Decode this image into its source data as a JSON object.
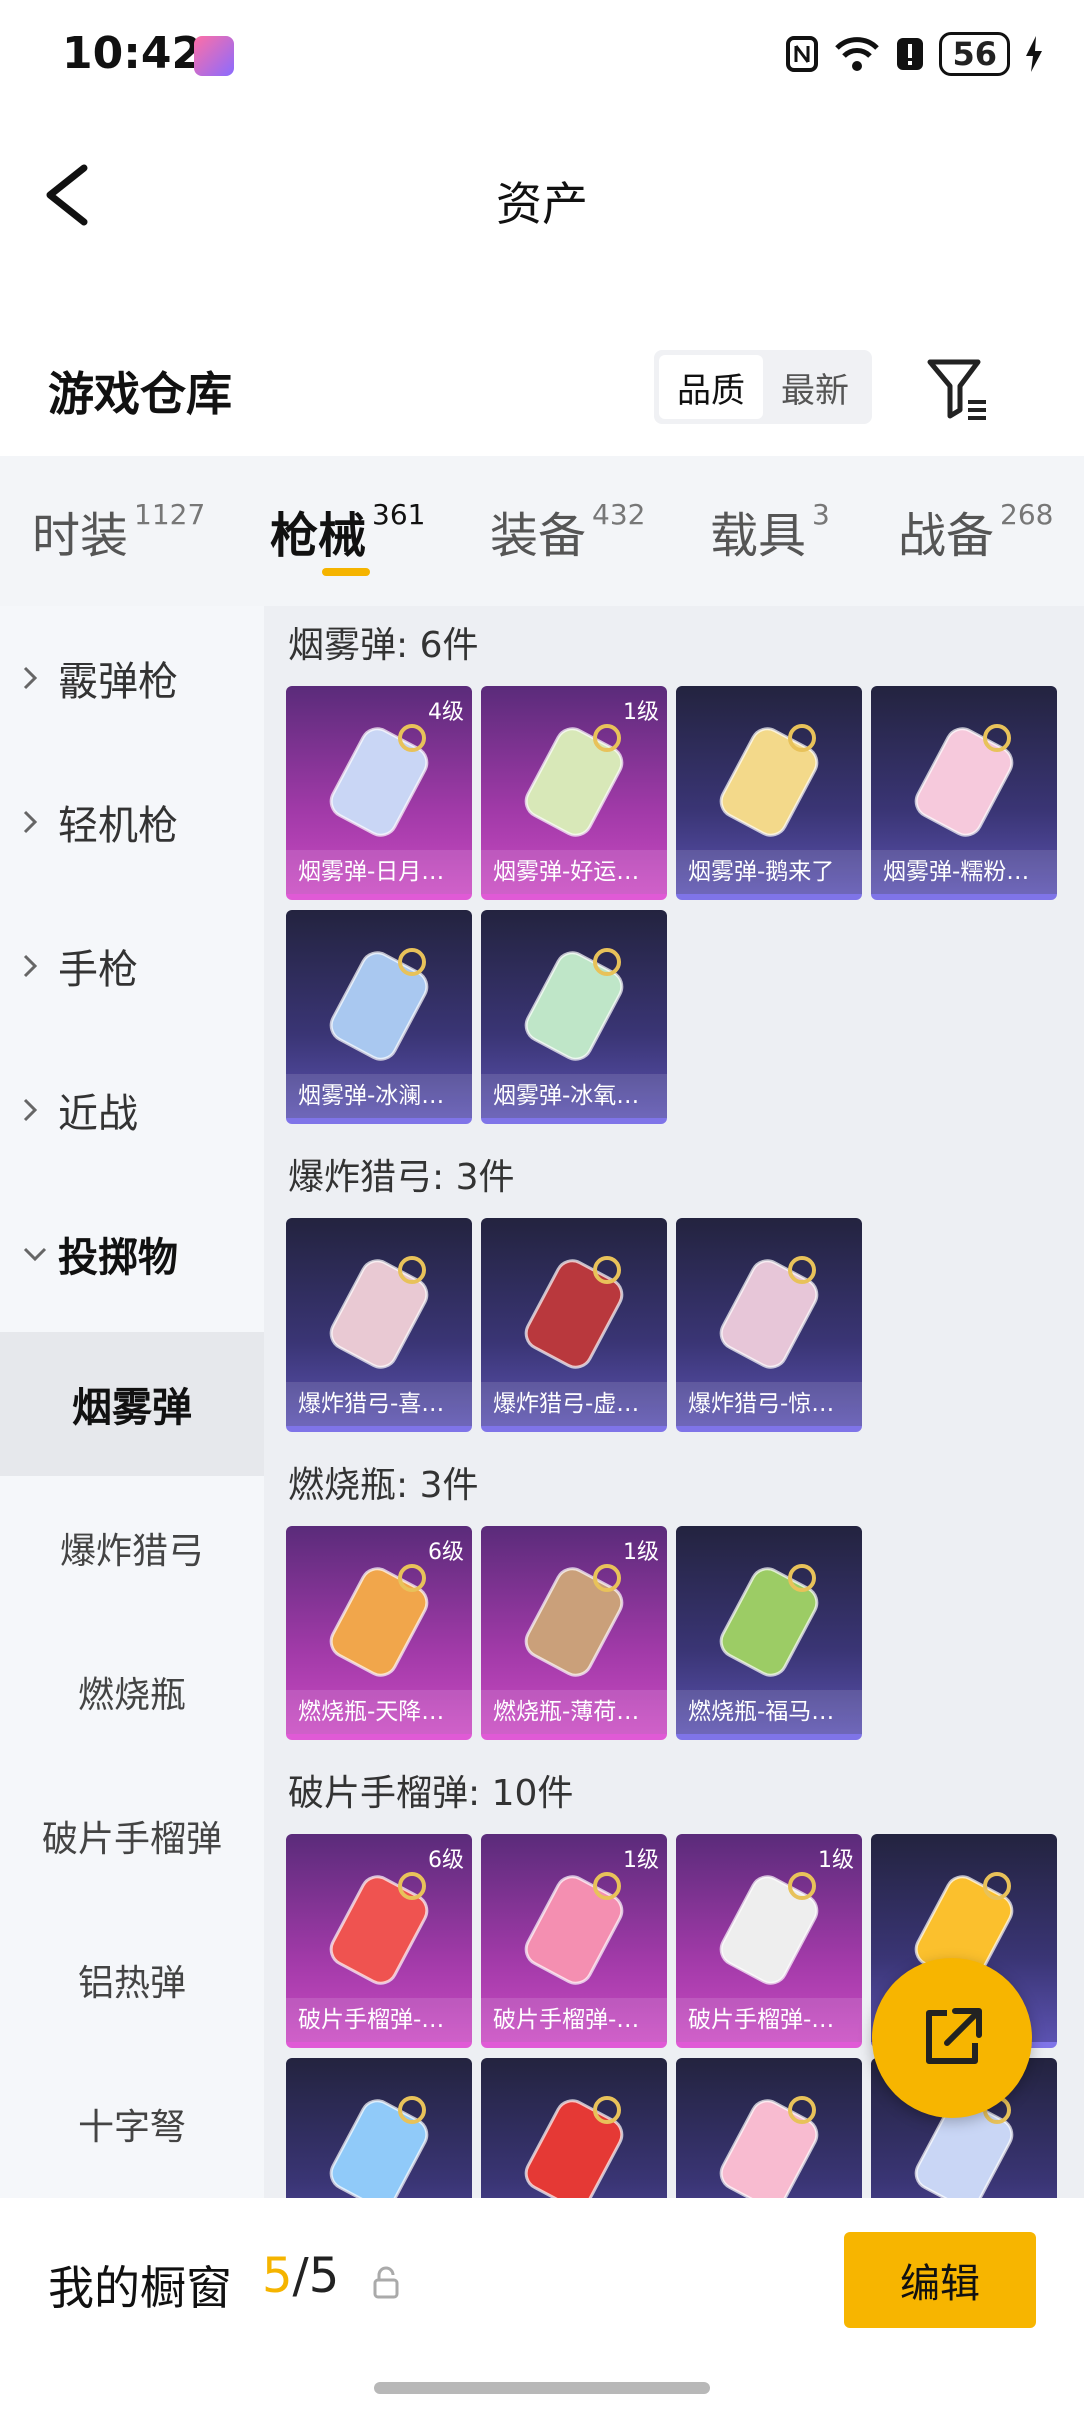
{
  "status_bar": {
    "time": "10:42",
    "battery": "56"
  },
  "header": {
    "title": "资产"
  },
  "warehouse": {
    "title": "游戏仓库",
    "sort_options": [
      {
        "label": "品质"
      },
      {
        "label": "最新"
      }
    ]
  },
  "tabs": [
    {
      "label": "时装",
      "count": "1127"
    },
    {
      "label": "枪械",
      "count": "361"
    },
    {
      "label": "装备",
      "count": "432"
    },
    {
      "label": "载具",
      "count": "3"
    },
    {
      "label": "战备",
      "count": "268"
    }
  ],
  "sidebar": {
    "categories": [
      {
        "label": "霰弹枪"
      },
      {
        "label": "轻机枪"
      },
      {
        "label": "手枪"
      },
      {
        "label": "近战"
      },
      {
        "label": "投掷物"
      }
    ],
    "subcategories": [
      {
        "label": "烟雾弹"
      },
      {
        "label": "爆炸猎弓"
      },
      {
        "label": "燃烧瓶"
      },
      {
        "label": "破片手榴弹"
      },
      {
        "label": "铝热弹"
      },
      {
        "label": "十字弩"
      }
    ]
  },
  "sections": [
    {
      "title": "烟雾弹: 6件",
      "items": [
        {
          "name": "烟雾弹-日月…",
          "level": "4级",
          "rarity": "purple"
        },
        {
          "name": "烟雾弹-好运…",
          "level": "1级",
          "rarity": "purple"
        },
        {
          "name": "烟雾弹-鹅来了",
          "level": "",
          "rarity": "blue"
        },
        {
          "name": "烟雾弹-糯粉…",
          "level": "",
          "rarity": "blue"
        },
        {
          "name": "烟雾弹-冰澜…",
          "level": "",
          "rarity": "blue"
        },
        {
          "name": "烟雾弹-冰氧…",
          "level": "",
          "rarity": "blue"
        }
      ]
    },
    {
      "title": "爆炸猎弓: 3件",
      "items": [
        {
          "name": "爆炸猎弓-喜…",
          "level": "",
          "rarity": "blue"
        },
        {
          "name": "爆炸猎弓-虚…",
          "level": "",
          "rarity": "blue"
        },
        {
          "name": "爆炸猎弓-惊…",
          "level": "",
          "rarity": "blue"
        }
      ]
    },
    {
      "title": "燃烧瓶: 3件",
      "items": [
        {
          "name": "燃烧瓶-天降…",
          "level": "6级",
          "rarity": "purple"
        },
        {
          "name": "燃烧瓶-薄荷…",
          "level": "1级",
          "rarity": "purple"
        },
        {
          "name": "燃烧瓶-福马…",
          "level": "",
          "rarity": "blue"
        }
      ]
    },
    {
      "title": "破片手榴弹: 10件",
      "items": [
        {
          "name": "破片手榴弹-…",
          "level": "6级",
          "rarity": "purple"
        },
        {
          "name": "破片手榴弹-…",
          "level": "1级",
          "rarity": "purple"
        },
        {
          "name": "破片手榴弹-…",
          "level": "1级",
          "rarity": "purple"
        },
        {
          "name": "",
          "level": "",
          "rarity": "blue"
        },
        {
          "name": "",
          "level": "",
          "rarity": "blue"
        },
        {
          "name": "",
          "level": "",
          "rarity": "blue"
        },
        {
          "name": "",
          "level": "",
          "rarity": "blue"
        },
        {
          "name": "",
          "level": "",
          "rarity": "blue"
        }
      ]
    }
  ],
  "showcase": {
    "label": "我的橱窗",
    "current": "5",
    "separator": "/",
    "total": "5",
    "edit_label": "编辑"
  },
  "colors": {
    "accent": "#f7b500",
    "purple_card": "#a13aa8",
    "blue_card": "#3a3575"
  }
}
